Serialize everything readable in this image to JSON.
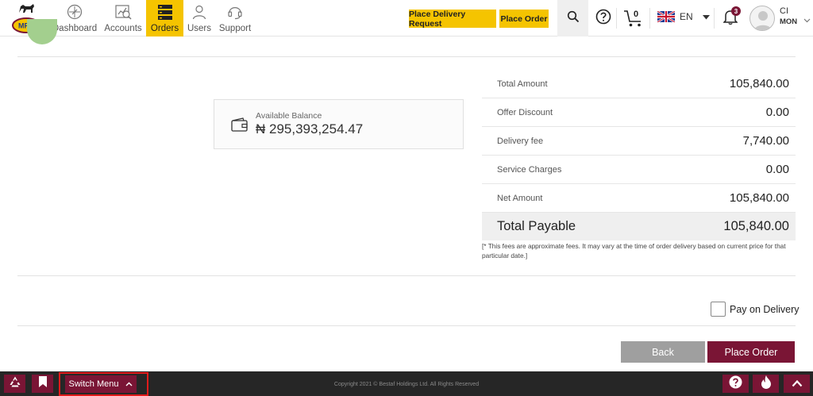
{
  "brand": {
    "logo_text": "MRS",
    "accent": "#7a1535",
    "highlight": "#f5c400"
  },
  "nav": {
    "items": [
      {
        "label": "Dashboard",
        "icon": "compass-icon"
      },
      {
        "label": "Accounts",
        "icon": "report-icon"
      },
      {
        "label": "Orders",
        "icon": "orders-icon",
        "active": true
      },
      {
        "label": "Users",
        "icon": "user-icon"
      },
      {
        "label": "Support",
        "icon": "headset-icon"
      }
    ]
  },
  "header": {
    "place_delivery_request": "Place Delivery Request",
    "place_order": "Place Order",
    "cart_count": "0",
    "language": "EN",
    "notification_count": "3",
    "user_initials_line1": "CI",
    "user_initials_line2": "MON"
  },
  "balance": {
    "label": "Available Balance",
    "amount": "₦ 295,393,254.47"
  },
  "summary": {
    "rows": [
      {
        "label": "Total Amount",
        "value": "105,840.00"
      },
      {
        "label": "Offer Discount",
        "value": "0.00"
      },
      {
        "label": "Delivery fee",
        "value": "7,740.00"
      },
      {
        "label": "Service Charges",
        "value": "0.00"
      },
      {
        "label": "Net Amount",
        "value": "105,840.00"
      }
    ],
    "total_label": "Total Payable",
    "total_value": "105,840.00",
    "note": "[* This fees are approximate fees. It may vary at the time of order delivery based on current price for that particular date.]"
  },
  "pay_on_delivery": {
    "label": "Pay on Delivery",
    "checked": false
  },
  "actions": {
    "back": "Back",
    "place_order": "Place Order"
  },
  "footer": {
    "switch_menu": "Switch Menu",
    "copyright": "Copyright 2021 © Bestaf Holdings Ltd. All Rights Reserved"
  }
}
